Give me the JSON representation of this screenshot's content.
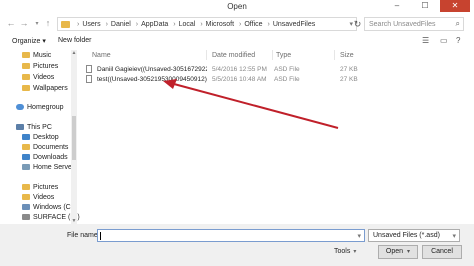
{
  "window": {
    "title": "Open",
    "minimize": "–",
    "maximize": "☐",
    "close": "✕"
  },
  "address": {
    "back": "←",
    "forward": "→",
    "up": "↑",
    "crumbs": [
      "Users",
      "Daniel",
      "AppData",
      "Local",
      "Microsoft",
      "Office",
      "UnsavedFiles"
    ],
    "separator": "›",
    "dropdown": "▾",
    "refresh": "↻"
  },
  "search": {
    "placeholder": "Search UnsavedFiles",
    "icon": "⌕"
  },
  "toolbar": {
    "organize": "Organize ▾",
    "new_folder": "New folder",
    "view_icon": "☰",
    "help_icon": "?"
  },
  "sidebar": {
    "items": [
      {
        "label": "Music",
        "icon": "music-icon",
        "color": "#e8b84a",
        "sub": true
      },
      {
        "label": "Pictures",
        "icon": "pictures-icon",
        "color": "#e8b84a",
        "sub": true
      },
      {
        "label": "Videos",
        "icon": "videos-icon",
        "color": "#e8b84a",
        "sub": true
      },
      {
        "label": "Wallpapers",
        "icon": "folder-icon",
        "color": "#e8b84a",
        "sub": true
      },
      {
        "label": "Homegroup",
        "icon": "homegroup-icon",
        "color": "#4f8fd6",
        "sub": false
      },
      {
        "label": "This PC",
        "icon": "pc-icon",
        "color": "#5c7fa8",
        "sub": false
      },
      {
        "label": "Desktop",
        "icon": "desktop-icon",
        "color": "#3f83c9",
        "sub": true
      },
      {
        "label": "Documents",
        "icon": "documents-icon",
        "color": "#e8b84a",
        "sub": true
      },
      {
        "label": "Downloads",
        "icon": "downloads-icon",
        "color": "#3f83c9",
        "sub": true
      },
      {
        "label": "Home Server",
        "icon": "server-icon",
        "color": "#7a9bb6",
        "sub": true
      },
      {
        "label": "Pictures",
        "icon": "pictures-icon",
        "color": "#e8b84a",
        "sub": true
      },
      {
        "label": "Videos",
        "icon": "videos-icon",
        "color": "#e8b84a",
        "sub": true
      },
      {
        "label": "Windows (C:)",
        "icon": "drive-icon",
        "color": "#6b8fb8",
        "sub": true
      },
      {
        "label": "SURFACE (D:)",
        "icon": "drive-icon",
        "color": "#8a8a8a",
        "sub": true
      }
    ]
  },
  "columns": {
    "name": "Name",
    "date_modified": "Date modified",
    "type": "Type",
    "size": "Size"
  },
  "files": [
    {
      "name": "Daniil Gagieiev((Unsaved-3051672922443...",
      "date": "5/4/2016 12:55 PM",
      "type": "ASD File",
      "size": "27 KB"
    },
    {
      "name": "test((Unsaved-305219530009450912)).asd",
      "date": "5/5/2016 10:48 AM",
      "type": "ASD File",
      "size": "27 KB"
    }
  ],
  "bottom": {
    "file_name_label": "File name:",
    "file_name_value": "",
    "filter": "Unsaved Files (*.asd)",
    "tools": "Tools",
    "open": "Open",
    "cancel": "Cancel",
    "dropdown": "▾"
  },
  "colors": {
    "close_button": "#c7432f",
    "annotation_arrow": "#c0202a",
    "folder": "#e8b84a",
    "bottom_bar": "#f0f0f0"
  }
}
